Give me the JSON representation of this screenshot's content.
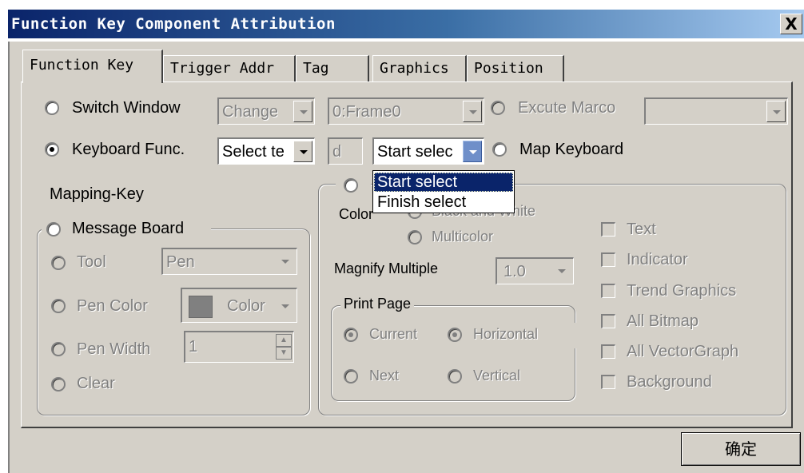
{
  "window": {
    "title": "Function Key Component Attribution",
    "close_label": "X"
  },
  "tabs": [
    {
      "label": "Function Key",
      "active": true
    },
    {
      "label": "Trigger Addr",
      "active": false
    },
    {
      "label": "Tag",
      "active": false
    },
    {
      "label": "Graphics",
      "active": false
    },
    {
      "label": "Position",
      "active": false
    }
  ],
  "function_key": {
    "switch_window": {
      "label": "Switch Window",
      "selected": false
    },
    "change_combo": {
      "value": "Change"
    },
    "frame_combo": {
      "value": "0:Frame0"
    },
    "excute_marco": {
      "label": "Excute Marco"
    },
    "keyboard_func": {
      "label": "Keyboard Func.",
      "selected": true
    },
    "select_combo": {
      "value": "Select te"
    },
    "d_field": {
      "value": "d"
    },
    "start_combo": {
      "value": "Start selec"
    },
    "map_keyboard": {
      "label": "Map Keyboard"
    },
    "mapping_key_label": "Mapping-Key",
    "dropdown_options": [
      "Start select",
      "Finish select"
    ],
    "dropdown_selected": "Start select"
  },
  "message_board": {
    "label": "Message Board",
    "tool": {
      "label": "Tool",
      "value": "Pen"
    },
    "pen_color": {
      "label": "Pen Color",
      "value": "Color",
      "swatch": "#808080"
    },
    "pen_width": {
      "label": "Pen Width",
      "value": "1"
    },
    "clear": {
      "label": "Clear"
    }
  },
  "print_group": {
    "color_label": "Color",
    "black_white": "Black and White",
    "multicolor": "Multicolor",
    "magnify_label": "Magnify Multiple",
    "magnify_value": "1.0",
    "print_page_label": "Print Page",
    "current": "Current",
    "horizontal": "Horizontal",
    "next": "Next",
    "vertical": "Vertical"
  },
  "checkboxes": [
    "Text",
    "Indicator",
    "Trend Graphics",
    "All Bitmap",
    "All VectorGraph",
    "Background"
  ],
  "ok_button": "确定"
}
